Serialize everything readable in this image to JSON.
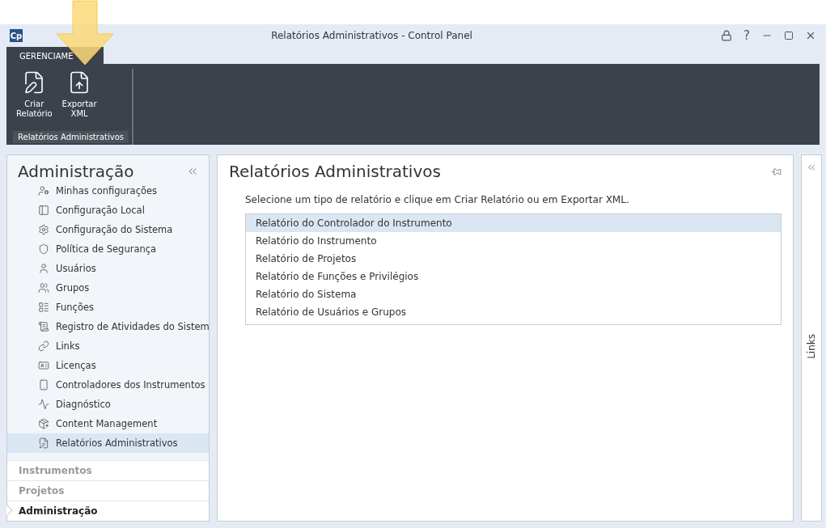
{
  "window": {
    "title": "Relatórios Administrativos - Control Panel",
    "logo": "Cp",
    "help": "?"
  },
  "ribbon": {
    "tab": "GERENCIAME",
    "buttons": [
      {
        "label": "Criar\nRelatório",
        "kind": "create"
      },
      {
        "label": "Exportar\nXML",
        "kind": "export"
      }
    ],
    "group": "Relatórios Administrativos"
  },
  "sidebar": {
    "title": "Administração",
    "items": [
      {
        "label": "Minhas configurações",
        "kind": "settings",
        "selected": false
      },
      {
        "label": "Configuração Local",
        "kind": "local",
        "selected": false
      },
      {
        "label": "Configuração do Sistema",
        "kind": "gear",
        "selected": false
      },
      {
        "label": "Política de Segurança",
        "kind": "shield",
        "selected": false
      },
      {
        "label": "Usuários",
        "kind": "user",
        "selected": false
      },
      {
        "label": "Grupos",
        "kind": "group",
        "selected": false
      },
      {
        "label": "Funções",
        "kind": "role",
        "selected": false
      },
      {
        "label": "Registro de Atividades do Sistem",
        "kind": "log",
        "selected": false
      },
      {
        "label": "Links",
        "kind": "link",
        "selected": false
      },
      {
        "label": "Licenças",
        "kind": "license",
        "selected": false
      },
      {
        "label": "Controladores dos Instrumentos",
        "kind": "device",
        "selected": false
      },
      {
        "label": "Diagnóstico",
        "kind": "diag",
        "selected": false
      },
      {
        "label": "Content Management",
        "kind": "content",
        "selected": false
      },
      {
        "label": "Relatórios Administrativos",
        "kind": "report",
        "selected": true
      }
    ],
    "nav": [
      {
        "label": "Instrumentos",
        "selected": false
      },
      {
        "label": "Projetos",
        "selected": false
      },
      {
        "label": "Administração",
        "selected": true
      }
    ]
  },
  "main": {
    "title": "Relatórios Administrativos",
    "instruction": "Selecione um tipo de relatório e clique em Criar Relatório ou em Exportar XML.",
    "reports": [
      {
        "label": "Relatório do Controlador do Instrumento",
        "selected": true
      },
      {
        "label": "Relatório do Instrumento",
        "selected": false
      },
      {
        "label": "Relatório de Projetos",
        "selected": false
      },
      {
        "label": "Relatório de Funções e Privilégios",
        "selected": false
      },
      {
        "label": "Relatório do Sistema",
        "selected": false
      },
      {
        "label": "Relatório de Usuários e Grupos",
        "selected": false
      }
    ]
  },
  "right_panel": {
    "title": "Links"
  }
}
